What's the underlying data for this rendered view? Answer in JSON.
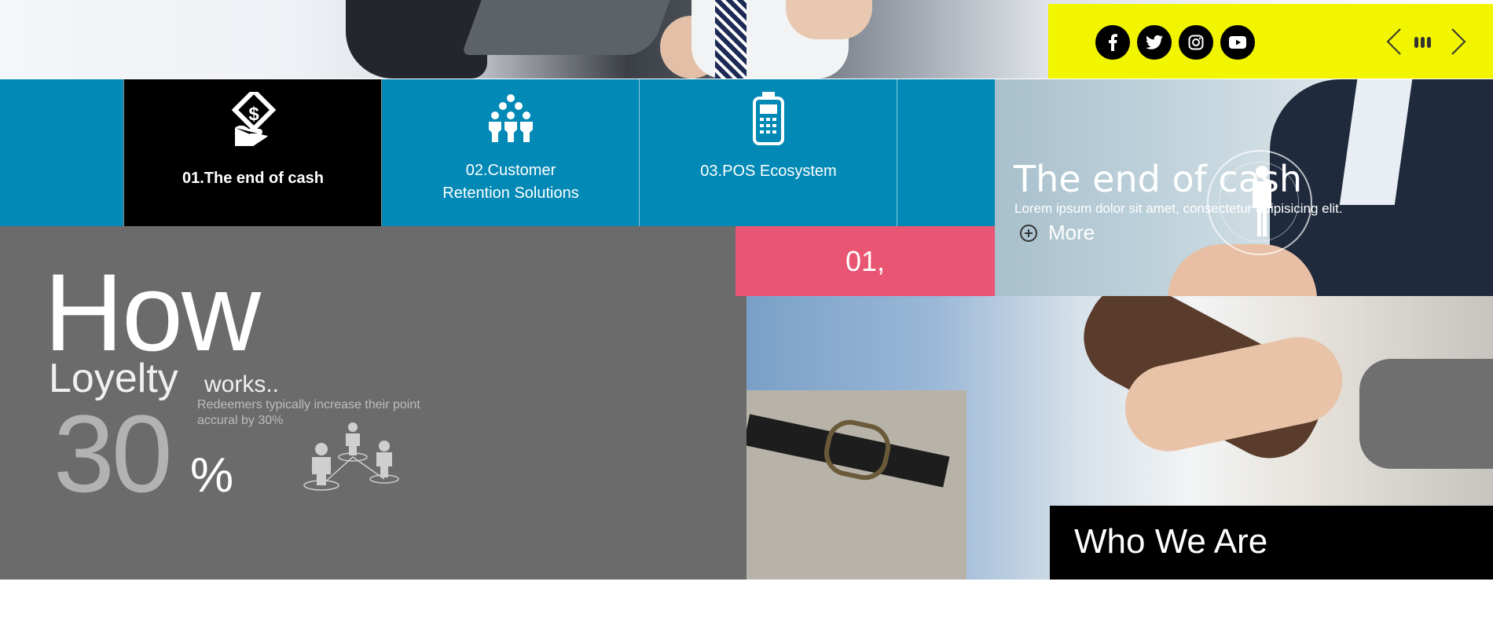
{
  "social": {
    "facebook": "f",
    "twitter": "t",
    "instagram": "ig",
    "youtube": "yt"
  },
  "services": [
    {
      "label": "01.The end of cash",
      "icon": "money-hand-icon",
      "active": true
    },
    {
      "label": "02.Customer Retention Solutions",
      "icon": "people-network-icon",
      "active": false
    },
    {
      "label": "03.POS Ecosystem",
      "icon": "pos-terminal-icon",
      "active": false
    }
  ],
  "slide": {
    "title": "The end of cash",
    "text": "Lorem ipsum dolor sit amet, consectetur adipisicing elit.",
    "more": "More"
  },
  "counter": "01,",
  "loyalty": {
    "how": "How",
    "loyelty": "Loyelty",
    "works": "works..",
    "percent_value": "30",
    "percent_sign": "%",
    "description": "Redeemers typically increase their point accural by 30%"
  },
  "who_we_are": "Who We Are",
  "colors": {
    "social_bar": "#f2f500",
    "service_strip": "#0289b5",
    "counter": "#e95673",
    "loyalty_panel": "#6b6b6b"
  }
}
